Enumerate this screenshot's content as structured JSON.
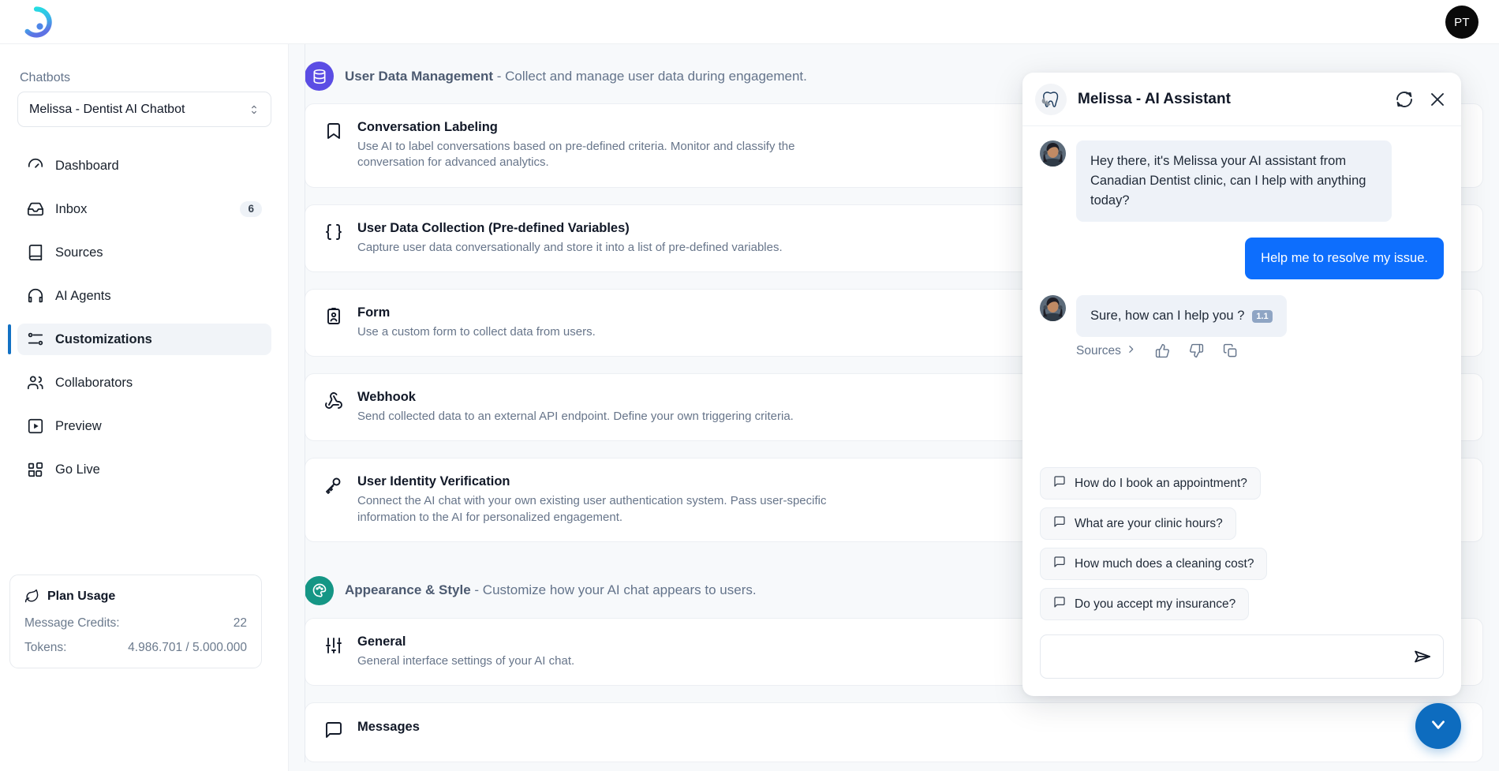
{
  "topbar": {
    "logo_icon": "brand-ring-logo",
    "user_initials": "PT"
  },
  "sidebar": {
    "section_label": "Chatbots",
    "chatbot_select": {
      "value": "Melissa - Dentist AI Chatbot",
      "icon": "chevron-up-down-icon"
    },
    "items": [
      {
        "label": "Dashboard",
        "icon": "gauge-icon",
        "active": false,
        "badge": ""
      },
      {
        "label": "Inbox",
        "icon": "inbox-icon",
        "active": false,
        "badge": "6"
      },
      {
        "label": "Sources",
        "icon": "book-icon",
        "active": false,
        "badge": ""
      },
      {
        "label": "AI Agents",
        "icon": "headset-icon",
        "active": false,
        "badge": ""
      },
      {
        "label": "Customizations",
        "icon": "sliders-icon",
        "active": true,
        "badge": ""
      },
      {
        "label": "Collaborators",
        "icon": "users-icon",
        "active": false,
        "badge": ""
      },
      {
        "label": "Preview",
        "icon": "play-square-icon",
        "active": false,
        "badge": ""
      },
      {
        "label": "Go Live",
        "icon": "blocks-icon",
        "active": false,
        "badge": ""
      }
    ],
    "plan_usage": {
      "title": "Plan Usage",
      "icon": "leaf-icon",
      "rows": [
        {
          "key": "Message Credits:",
          "value": "22"
        },
        {
          "key": "Tokens:",
          "value": "4.986.701 / 5.000.000"
        }
      ]
    }
  },
  "main": {
    "sections": [
      {
        "title": "User Data Management",
        "subtitle": " - Collect and manage user data during engagement.",
        "icon": "database-icon",
        "badge_color": "#5b4de4",
        "cards": [
          {
            "title": "Conversation Labeling",
            "desc": "Use AI to label conversations based on pre-defined criteria. Monitor and classify the conversation for advanced analytics.",
            "icon": "bookmark-icon"
          },
          {
            "title": "User Data Collection (Pre-defined Variables)",
            "desc": "Capture user data conversationally and store it into a list of pre-defined variables.",
            "icon": "braces-icon"
          },
          {
            "title": "Form",
            "desc": "Use a custom form to collect data from users.",
            "icon": "id-card-icon"
          },
          {
            "title": "Webhook",
            "desc": "Send collected data to an external API endpoint. Define your own triggering criteria.",
            "icon": "webhook-icon"
          },
          {
            "title": "User Identity Verification",
            "desc": "Connect the AI chat with your own existing user authentication system. Pass user-specific information to the AI for personalized engagement.",
            "icon": "key-icon"
          }
        ]
      },
      {
        "title": "Appearance & Style",
        "subtitle": " - Customize how your AI chat appears to users.",
        "icon": "palette-icon",
        "badge_color": "#159685",
        "cards": [
          {
            "title": "General",
            "desc": "General interface settings of your AI chat.",
            "icon": "sliders-vertical-icon"
          },
          {
            "title": "Messages",
            "desc": "",
            "icon": "message-square-icon"
          }
        ]
      }
    ]
  },
  "chat_widget": {
    "title": "Melissa - AI Assistant",
    "brand_icon": "tooth-logo-icon",
    "refresh_icon": "refresh-icon",
    "close_icon": "close-icon",
    "messages": [
      {
        "role": "bot",
        "text": "Hey there, it's Melissa your AI assistant from Canadian Dentist clinic, can I help with anything today?",
        "version": ""
      },
      {
        "role": "user",
        "text": "Help me to resolve my issue.",
        "version": ""
      },
      {
        "role": "bot",
        "text": "Sure, how can I help you ?",
        "version": "1.1"
      }
    ],
    "feedback": {
      "sources_label": "Sources",
      "chevron_icon": "chevron-right-icon",
      "thumbs_up_icon": "thumbs-up-icon",
      "thumbs_down_icon": "thumbs-down-icon",
      "copy_icon": "copy-icon"
    },
    "suggestions": [
      "How do I book an appointment?",
      "What are your clinic hours?",
      "How much does a cleaning cost?",
      "Do you accept my insurance?"
    ],
    "composer": {
      "value": "",
      "placeholder": "",
      "send_icon": "send-icon"
    },
    "fab_icon": "chevron-down-icon",
    "accent_color": "#0d6efd",
    "fab_color": "#0d6cbf"
  }
}
